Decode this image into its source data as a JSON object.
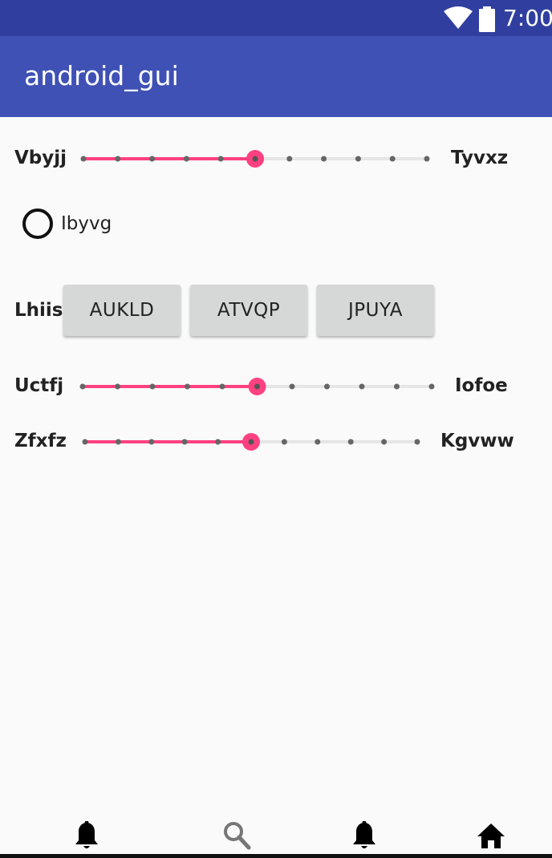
{
  "status_bar": {
    "time": "7:00",
    "icons": [
      "wifi-icon",
      "battery-icon"
    ]
  },
  "app_bar": {
    "title": "android_gui"
  },
  "seekbars": [
    {
      "start_label": "Vbyjj",
      "end_label": "Tyvxz",
      "value": 5,
      "max": 10
    },
    {
      "start_label": "Uctfj",
      "end_label": "Iofoe",
      "value": 5,
      "max": 10
    },
    {
      "start_label": "Zfxfz",
      "end_label": "Kgvww",
      "value": 5,
      "max": 10
    }
  ],
  "radio": {
    "label": "Ibyvg",
    "checked": false
  },
  "button_row": {
    "label": "Lhiis",
    "buttons": [
      "AUKLD",
      "ATVQP",
      "JPUYA"
    ]
  },
  "bottom_nav": {
    "items": [
      "bell-icon",
      "search-icon",
      "bell-icon",
      "home-icon"
    ]
  },
  "colors": {
    "status_bar": "#303f9f",
    "app_bar": "#3f51b5",
    "accent": "#ff4081",
    "background": "#fafafa"
  }
}
